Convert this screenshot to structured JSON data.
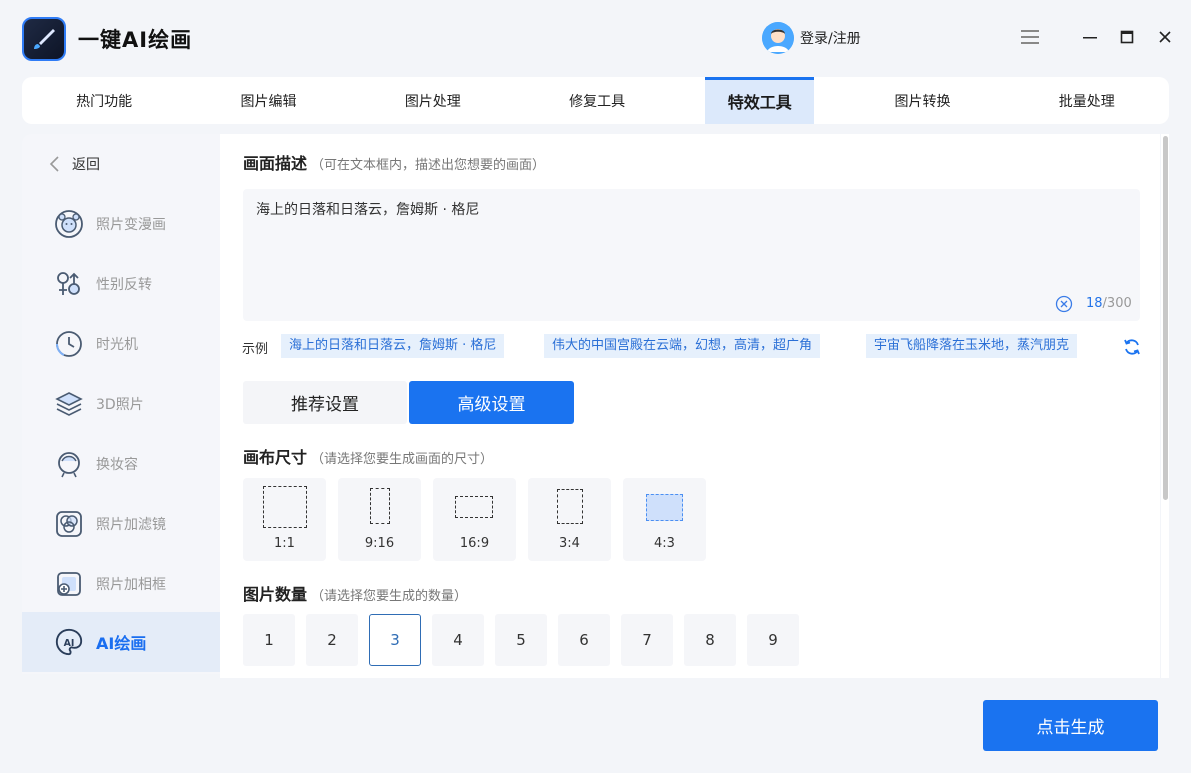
{
  "app": {
    "title": "一键AI绘画",
    "login": "登录/注册"
  },
  "tabs": [
    "热门功能",
    "图片编辑",
    "图片处理",
    "修复工具",
    "特效工具",
    "图片转换",
    "批量处理"
  ],
  "sidebar": {
    "back": "返回",
    "items": [
      "照片变漫画",
      "性别反转",
      "时光机",
      "3D照片",
      "换妆容",
      "照片加滤镜",
      "照片加相框",
      "AI绘画"
    ]
  },
  "description": {
    "title": "画面描述",
    "hint": "（可在文本框内，描述出您想要的画面）",
    "value": "海上的日落和日落云，詹姆斯 · 格尼",
    "count": "18",
    "max": "/300"
  },
  "examples": {
    "label": "示例",
    "items": [
      "海上的日落和日落云，詹姆斯 · 格尼",
      "伟大的中国宫殿在云端，幻想，高清，超广角",
      "宇宙飞船降落在玉米地，蒸汽朋克"
    ]
  },
  "modes": {
    "recommended": "推荐设置",
    "advanced": "高级设置",
    "selected": "高级设置"
  },
  "canvas": {
    "title": "画布尺寸",
    "hint": "（请选择您要生成画面的尺寸）",
    "options": [
      "1:1",
      "9:16",
      "16:9",
      "3:4",
      "4:3"
    ],
    "selected": "4:3"
  },
  "quantity": {
    "title": "图片数量",
    "hint": "（请选择您要生成的数量）",
    "options": [
      "1",
      "2",
      "3",
      "4",
      "5",
      "6",
      "7",
      "8",
      "9"
    ],
    "selected": "3"
  },
  "generate": "点击生成",
  "colors": {
    "accent": "#1a73f0",
    "chip_bg": "#e6f0fc",
    "active_tab_bg": "#dce9fb"
  }
}
